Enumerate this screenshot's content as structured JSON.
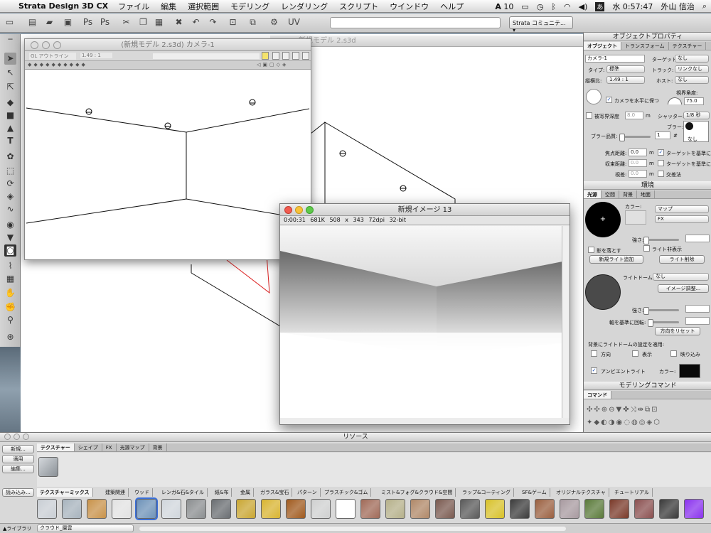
{
  "menubar": {
    "app_name": "Strata Design 3D CX",
    "menus": [
      "ファイル",
      "編集",
      "選択範囲",
      "モデリング",
      "レンダリング",
      "スクリプト",
      "ウインドウ",
      "ヘルプ"
    ],
    "adobe_badge": "10",
    "clock": "水 0:57:47",
    "user": "外山 信治",
    "input_menu": "あ"
  },
  "toolbar": {
    "community_label": "Strata コミュニテ..."
  },
  "background_window": {
    "title": "新規モデル 2.s3d"
  },
  "camera_window": {
    "title": "(新規モデル 2.s3d) カメラ-1",
    "render_mode": "GL アウトライン",
    "scale": "1.49 : 1"
  },
  "render_window": {
    "title": "新規イメージ 13",
    "time": "0:00:31",
    "size": "681K",
    "dimensions": "508 x 343",
    "dpi": "72dpi",
    "bits": "32-bit"
  },
  "object_properties": {
    "title": "オブジェクトプロパティ",
    "tabs": [
      "オブジェクト",
      "トランスフォーム",
      "テクスチャー"
    ],
    "name_value": "カメラ-1",
    "target_label": "ターゲット:",
    "target_value": "なし",
    "type_label": "タイプ:",
    "type_value": "標準",
    "track_label": "トラック:",
    "track_value": "リンクなし",
    "aspect_label": "縦横比:",
    "aspect_value": "1.49 : 1",
    "host_label": "ホスト:",
    "host_value": "なし",
    "fov_label": "視界角度:",
    "fov_value": "75.0",
    "level_label": "カメラを水平に保つ",
    "dof_label": "被写界深度",
    "dof_value": "8.0",
    "dof_unit": "m",
    "shutter_label": "シャッター:",
    "shutter_value": "1/8 秒",
    "blur_label": "ブラー:",
    "blur_quality_label": "ブラー品質:",
    "blur_quality_value": "1",
    "blur_hash": "#",
    "blur_none": "なし",
    "focus_label": "焦点距離:",
    "focus_value": "0.0",
    "focus_unit": "m",
    "target_base1": "ターゲットを基準に",
    "converge_label": "収束距離:",
    "converge_value": "0.0",
    "converge_unit": "m",
    "target_base2": "ターゲットを基準に",
    "parallax_label": "視差:",
    "parallax_value": "0.0",
    "parallax_unit": "m",
    "cross_label": "交差法"
  },
  "environment": {
    "title": "環境",
    "tabs": [
      "光源",
      "空間",
      "背景",
      "地面"
    ],
    "color_label": "カラー:",
    "map_value": "マップ",
    "fx_value": "FX",
    "strength_label": "強さ:",
    "shadow_label": "影を落とす",
    "hide_light_label": "ライト非表示",
    "add_light_button": "新規ライト追加",
    "delete_light_button": "ライト削除",
    "dome_label": "ライトドーム:",
    "dome_value": "なし",
    "adjust_image_button": "イメージ調整...",
    "strength2_label": "強さ:",
    "rotate_label": "軸を基準に回転:",
    "reset_dir_button": "方向をリセット",
    "apply_label": "背景にライトドームの設定を適用:",
    "dir_label": "方向",
    "show_label": "表示",
    "reflect_label": "映り込み",
    "ambient_label": "アンビエントライト",
    "ambient_color_label": "カラー:",
    "ambient_color": "#0a0a0a"
  },
  "modeling": {
    "title": "モデリングコマンド",
    "tab": "コマンド"
  },
  "resources": {
    "title": "リソース",
    "buttons": [
      "新規...",
      "適用",
      "編集..."
    ],
    "load_button": "読み込み...",
    "top_tabs": [
      "テクスチャー",
      "シェイプ",
      "FX",
      "光源マップ",
      "背景"
    ],
    "category_tabs": [
      "テクスチャーミックス",
      "建築関連",
      "ウッド",
      "レンガ&石&タイル",
      "紙&布",
      "金属",
      "ガラス&宝石",
      "パターン",
      "プラスチック&ゴム",
      "ミスト&フォグ&クラウド&空間",
      "ラップ&コーティング",
      "SF&ゲーム",
      "オリジナルテクスチャ",
      "チュートリアル"
    ],
    "library_label": "ライブラリ",
    "selected_texture": "クラウド_層雲",
    "swatch_colors": [
      "#c9ced4",
      "#a7b3bd",
      "#c8924a",
      "#e2e2e2",
      "#6f93b9",
      "#d0d6dc",
      "#8b8e90",
      "#6a6e72",
      "#c9a632",
      "#d8b431",
      "#a05a1e",
      "#cfd0d0",
      "#ffffff",
      "#a06a58",
      "#b5b08a",
      "#b08868",
      "#7a5a50",
      "#5a5a5a",
      "#d8c12a",
      "#3c3c3c",
      "#9a6040",
      "#a89aa0",
      "#5a7a3a",
      "#7a3a2a",
      "#8a5050",
      "#3a3a3a",
      "#8a33ee"
    ]
  }
}
